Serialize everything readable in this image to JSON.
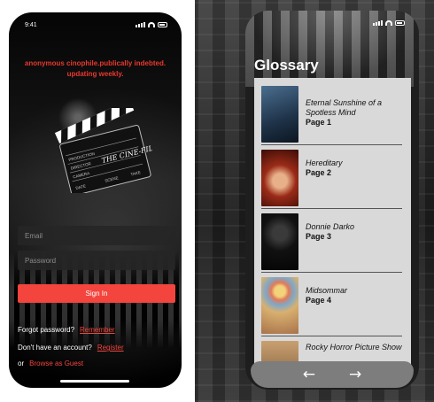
{
  "login_screen": {
    "time": "9:41",
    "tagline": "anonymous cinophile.publically indebted. updating weekly.",
    "clapperboard_text": [
      "HOLLYWOOD",
      "PRODUCTION",
      "DIRECTOR",
      "CAMERA",
      "DATE",
      "SCENE",
      "TAKE"
    ],
    "logo_text": "THE CINE-FILES",
    "email_placeholder": "Email",
    "password_placeholder": "Password",
    "signin_label": "Sign In",
    "forgot_text": "Forgot password?",
    "remember_link": "Remember",
    "no_account_text": "Don't have an account?",
    "register_link": "Register",
    "or_text": "or",
    "guest_link": "Browse as Guest"
  },
  "glossary_screen": {
    "title": "Glossary",
    "entries": [
      {
        "title": "Eternal Sunshine of a Spotless Mind",
        "page": "Page 1",
        "poster_color": "#2d4b68"
      },
      {
        "title": "Hereditary",
        "page": "Page 2",
        "poster_color": "#a0301c"
      },
      {
        "title": "Donnie Darko",
        "page": "Page 3",
        "poster_color": "#161616"
      },
      {
        "title": "Midsommar",
        "page": "Page 4",
        "poster_color": "#d7a85a"
      },
      {
        "title": "Rocky Horror Picture Show",
        "page": "",
        "poster_color": "#8a6a4a"
      }
    ],
    "back_icon": "left-arrow-icon",
    "forward_icon": "right-arrow-icon"
  },
  "colors": {
    "accent": "#f3453d",
    "tagline": "#e8382f"
  }
}
